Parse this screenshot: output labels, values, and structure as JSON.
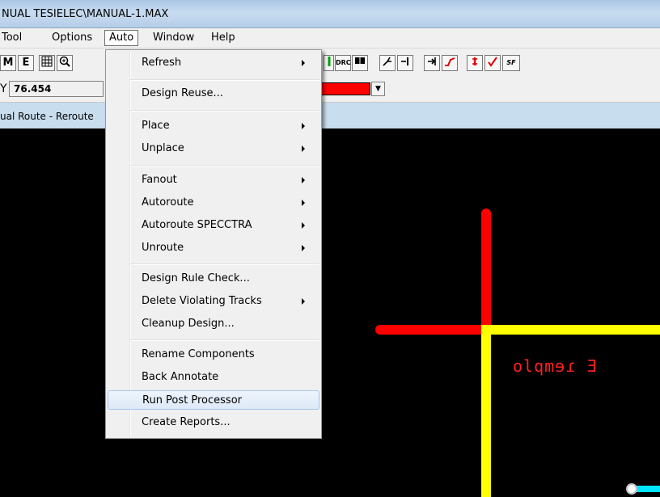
{
  "window": {
    "title": "NUAL TESIELEC\\MANUAL-1.MAX"
  },
  "menubar": [
    "Tool",
    "Options",
    "Auto",
    "Window",
    "Help"
  ],
  "toolbar": {
    "icon_left_1": "M",
    "icon_left_2": "E",
    "icon_drc": "DRC",
    "icon_sf": "SF"
  },
  "coords": {
    "label": "Y",
    "value": "76.454"
  },
  "layer": {
    "color": "#ff0000"
  },
  "status": {
    "text": "ual Route - Reroute"
  },
  "canvas": {
    "mirrored_text": "olqmɘɾ Ǝ",
    "track_colors": {
      "red": "#ff0000",
      "yellow": "#ffff00",
      "cyan": "#00e5ff"
    }
  },
  "auto_menu": {
    "items": [
      {
        "label": "Refresh",
        "submenu": true
      },
      {
        "label": "Design Reuse...",
        "submenu": false
      },
      {
        "label": "Place",
        "submenu": true
      },
      {
        "label": "Unplace",
        "submenu": true
      },
      {
        "label": "Fanout",
        "submenu": true
      },
      {
        "label": "Autoroute",
        "submenu": true
      },
      {
        "label": "Autoroute SPECCTRA",
        "submenu": true
      },
      {
        "label": "Unroute",
        "submenu": true
      },
      {
        "label": "Design Rule Check...",
        "submenu": false
      },
      {
        "label": "Delete Violating Tracks",
        "submenu": true
      },
      {
        "label": "Cleanup Design...",
        "submenu": false
      },
      {
        "label": "Rename Components",
        "submenu": false
      },
      {
        "label": "Back Annotate",
        "submenu": false
      },
      {
        "label": "Run Post Processor",
        "submenu": false,
        "highlighted": true
      },
      {
        "label": "Create Reports...",
        "submenu": false
      }
    ]
  }
}
